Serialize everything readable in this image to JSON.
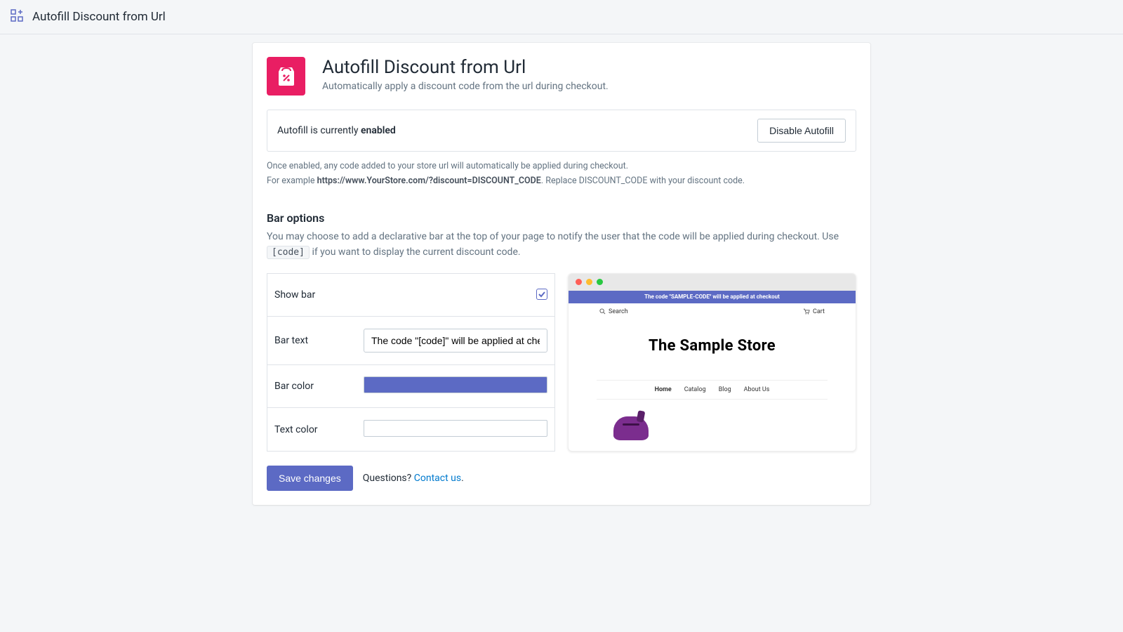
{
  "topbar": {
    "title": "Autofill Discount from Url"
  },
  "app": {
    "title": "Autofill Discount from Url",
    "subtitle": "Automatically apply a discount code from the url during checkout."
  },
  "status": {
    "prefix": "Autofill is currently ",
    "value": "enabled",
    "button": "Disable Autofill"
  },
  "help": {
    "line1": "Once enabled, any code added to your store url will automatically be applied during checkout.",
    "line2_prefix": "For example ",
    "line2_url": "https://www.YourStore.com/?discount=DISCOUNT_CODE",
    "line2_suffix": ". Replace DISCOUNT_CODE with your discount code."
  },
  "bar_section": {
    "heading": "Bar options",
    "desc_a": "You may choose to add a declarative bar at the top of your page to notify the user that the code will be applied during checkout. Use ",
    "desc_code": "[code]",
    "desc_b": " if you want to display the current discount code."
  },
  "options": {
    "show_bar": {
      "label": "Show bar",
      "checked": true
    },
    "bar_text": {
      "label": "Bar text",
      "value": "The code \"[code]\" will be applied at checkout"
    },
    "bar_color": {
      "label": "Bar color",
      "value": "#5c6ac4"
    },
    "text_color": {
      "label": "Text color",
      "value": "#ffffff"
    }
  },
  "preview": {
    "bar_text": "The code \"SAMPLE-CODE\" will be applied at checkout",
    "search": "Search",
    "cart": "Cart",
    "store_name": "The Sample Store",
    "menu": [
      "Home",
      "Catalog",
      "Blog",
      "About Us"
    ]
  },
  "footer": {
    "save": "Save changes",
    "questions": "Questions? ",
    "contact": "Contact us",
    "period": "."
  }
}
